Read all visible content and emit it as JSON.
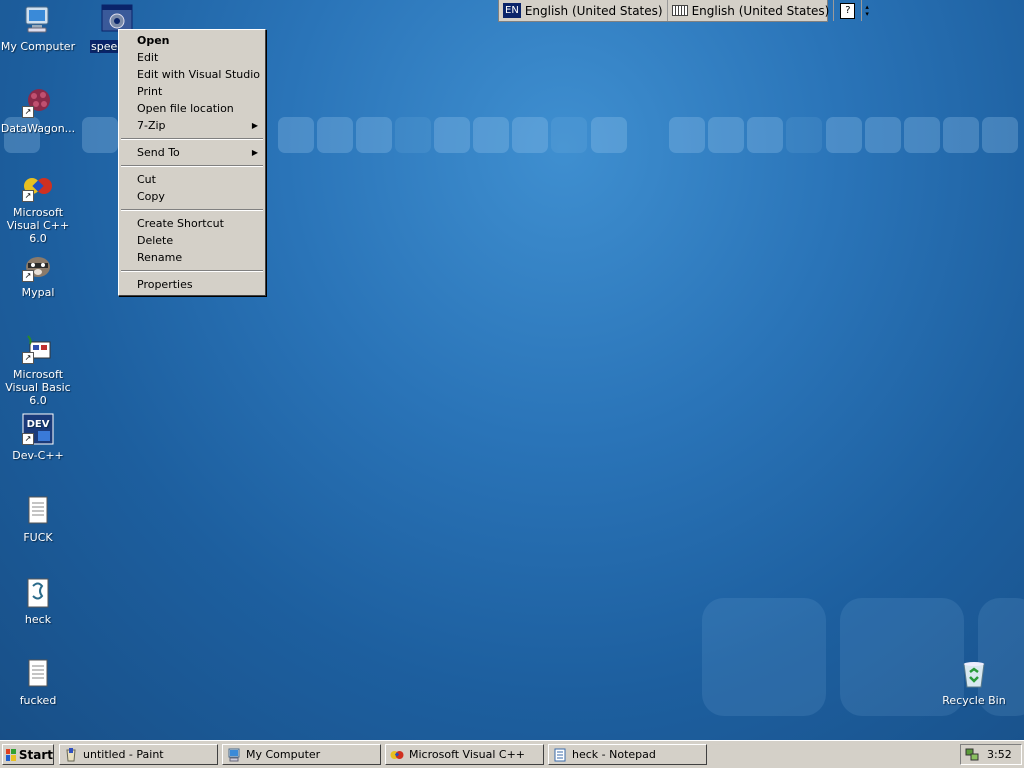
{
  "desktop": {
    "icons": [
      {
        "label": "My Computer"
      },
      {
        "label": "speed"
      },
      {
        "label": "DataWagon..."
      },
      {
        "label": "Microsoft Visual C++ 6.0"
      },
      {
        "label": "Mypal"
      },
      {
        "label": "Microsoft Visual Basic 6.0"
      },
      {
        "label": "Dev-C++"
      },
      {
        "label": "FUCK"
      },
      {
        "label": "heck"
      },
      {
        "label": "fucked"
      },
      {
        "label": "Recycle Bin"
      }
    ]
  },
  "langbar": {
    "badge": "EN",
    "language": "English (United States)",
    "keyboard": "English (United States)",
    "help": "?"
  },
  "context_menu": {
    "items": [
      {
        "label": "Open"
      },
      {
        "label": "Edit"
      },
      {
        "label": "Edit with Visual Studio"
      },
      {
        "label": "Print"
      },
      {
        "label": "Open file location"
      },
      {
        "label": "7-Zip"
      },
      {
        "label": "Send To"
      },
      {
        "label": "Cut"
      },
      {
        "label": "Copy"
      },
      {
        "label": "Create Shortcut"
      },
      {
        "label": "Delete"
      },
      {
        "label": "Rename"
      },
      {
        "label": "Properties"
      }
    ]
  },
  "taskbar": {
    "start_label": "Start",
    "tasks": [
      {
        "label": "untitled - Paint"
      },
      {
        "label": "My Computer"
      },
      {
        "label": "Microsoft Visual C++"
      },
      {
        "label": "heck - Notepad"
      }
    ],
    "clock": "3:52"
  },
  "colors": {
    "desktop_blue": "#2a74b8",
    "selection": "#0a246a",
    "chrome_gray": "#d4d0c8"
  }
}
